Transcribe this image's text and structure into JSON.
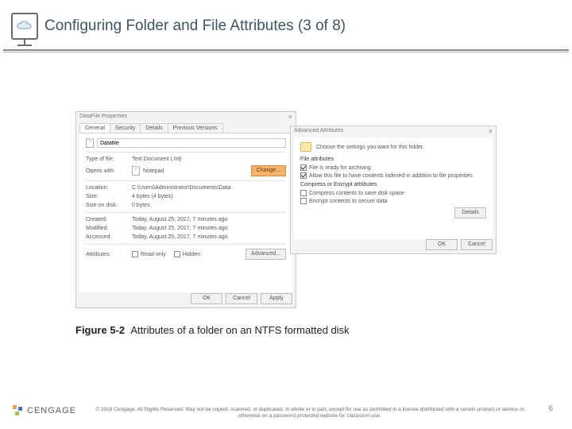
{
  "slide": {
    "title": "Configuring Folder and File Attributes (3 of 8)"
  },
  "props_dialog": {
    "title": "DataFile Properties",
    "tabs": {
      "general": "General",
      "security": "Security",
      "details": "Details",
      "previous": "Previous Versions"
    },
    "filename": "Datafile",
    "type_label": "Type of file:",
    "type_value": "Text Document (.txt)",
    "opens_label": "Opens with:",
    "opens_value": "Notepad",
    "change_btn": "Change...",
    "location_label": "Location:",
    "location_value": "C:\\Users\\Administrator\\Documents\\Data",
    "size_label": "Size:",
    "size_value": "4 bytes (4 bytes)",
    "sizeod_label": "Size on disk:",
    "sizeod_value": "0 bytes",
    "created_label": "Created:",
    "created_value": "Today, August 25, 2017, 7 minutes ago",
    "modified_label": "Modified:",
    "modified_value": "Today, August 25, 2017, 7 minutes ago",
    "accessed_label": "Accessed:",
    "accessed_value": "Today, August 25, 2017, 7 minutes ago",
    "attributes_label": "Attributes:",
    "readonly": "Read-only",
    "hidden": "Hidden",
    "advanced_btn": "Advanced...",
    "ok": "OK",
    "cancel": "Cancel",
    "apply": "Apply"
  },
  "adv_dialog": {
    "title": "Advanced Attributes",
    "intro": "Choose the settings you want for this folder.",
    "section1": "File attributes",
    "archive": "File is ready for archiving",
    "index": "Allow this file to have contents indexed in addition to file properties",
    "section2": "Compress or Encrypt attributes",
    "compress": "Compress contents to save disk space",
    "encrypt": "Encrypt contents to secure data",
    "details": "Details",
    "ok": "OK",
    "cancel": "Cancel"
  },
  "caption": {
    "fig": "Figure 5-2",
    "text": "Attributes of a folder on an NTFS formatted disk"
  },
  "footer": {
    "brand": "CENGAGE",
    "copyright": "© 2018 Cengage. All Rights Reserved. May not be copied, scanned, or duplicated, in whole or in part, except for use as permitted in a license distributed with a certain product or service or otherwise on a password-protected website for classroom use.",
    "page": "6"
  }
}
